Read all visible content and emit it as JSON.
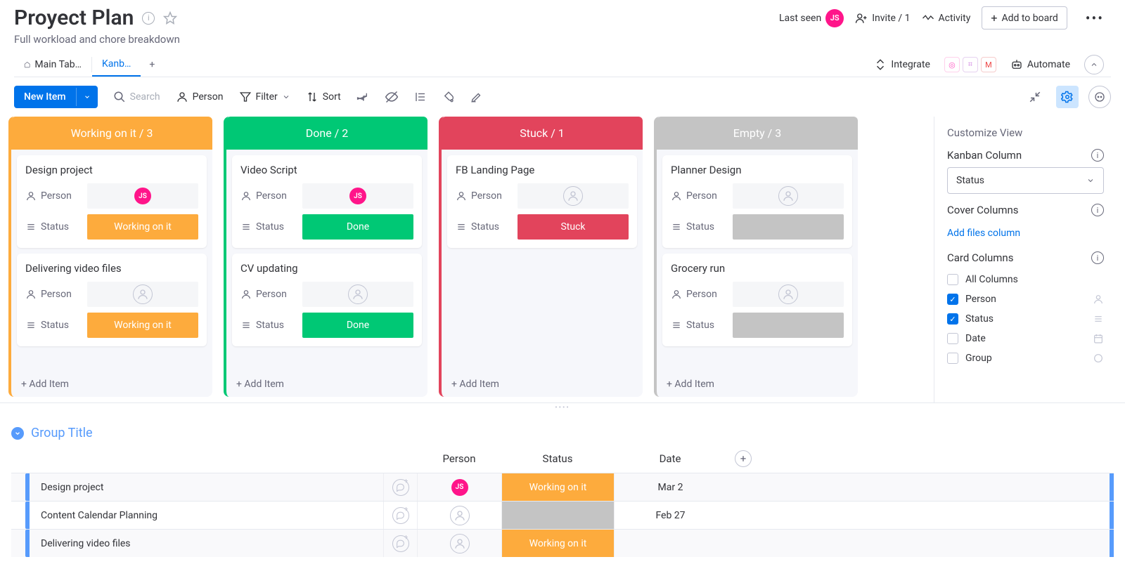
{
  "header": {
    "title": "Proyect Plan",
    "subtitle": "Full workload and chore breakdown",
    "last_seen": "Last seen",
    "avatar_initials": "JS",
    "invite": "Invite / 1",
    "activity": "Activity",
    "add_to_board": "Add to board"
  },
  "tabs": {
    "main": "Main Tab…",
    "kanban": "Kanb…",
    "integrate": "Integrate",
    "automate": "Automate"
  },
  "toolbar": {
    "new_item": "New Item",
    "search": "Search",
    "person": "Person",
    "filter": "Filter",
    "sort": "Sort"
  },
  "columns": [
    {
      "title": "Working on it / 3",
      "cls": "c1",
      "cards": [
        {
          "title": "Design project",
          "person": "JS",
          "status": "Working on it",
          "status_cls": "working"
        },
        {
          "title": "Delivering video files",
          "person": "",
          "status": "Working on it",
          "status_cls": "working"
        }
      ],
      "add": "+ Add Item"
    },
    {
      "title": "Done / 2",
      "cls": "c2",
      "cards": [
        {
          "title": "Video Script",
          "person": "JS",
          "status": "Done",
          "status_cls": "done"
        },
        {
          "title": "CV updating",
          "person": "",
          "status": "Done",
          "status_cls": "done"
        }
      ],
      "add": "+ Add Item"
    },
    {
      "title": "Stuck / 1",
      "cls": "c3",
      "cards": [
        {
          "title": "FB Landing Page",
          "person": "",
          "status": "Stuck",
          "status_cls": "stuck"
        }
      ],
      "add": "+ Add Item"
    },
    {
      "title": "Empty / 3",
      "cls": "c4",
      "cards": [
        {
          "title": "Planner Design",
          "person": "",
          "status": "",
          "status_cls": "empty"
        },
        {
          "title": "Grocery run",
          "person": "",
          "status": "",
          "status_cls": "empty"
        }
      ],
      "add": "+ Add Item"
    }
  ],
  "side": {
    "title": "Customize View",
    "kanban_col": "Kanban Column",
    "kanban_sel": "Status",
    "cover_cols": "Cover Columns",
    "add_files": "Add files column",
    "card_cols": "Card Columns",
    "all_cols": "All Columns",
    "person": "Person",
    "status": "Status",
    "date": "Date",
    "group": "Group"
  },
  "card_labels": {
    "person": "Person",
    "status": "Status"
  },
  "table": {
    "group_title": "Group Title",
    "head": {
      "person": "Person",
      "status": "Status",
      "date": "Date"
    },
    "rows": [
      {
        "name": "Design project",
        "person": "JS",
        "status": "Working on it",
        "status_cls": "working",
        "date": "Mar 2"
      },
      {
        "name": "Content Calendar Planning",
        "person": "",
        "status": "",
        "status_cls": "blank",
        "date": "Feb 27"
      },
      {
        "name": "Delivering video files",
        "person": "",
        "status": "Working on it",
        "status_cls": "working",
        "date": ""
      }
    ]
  }
}
